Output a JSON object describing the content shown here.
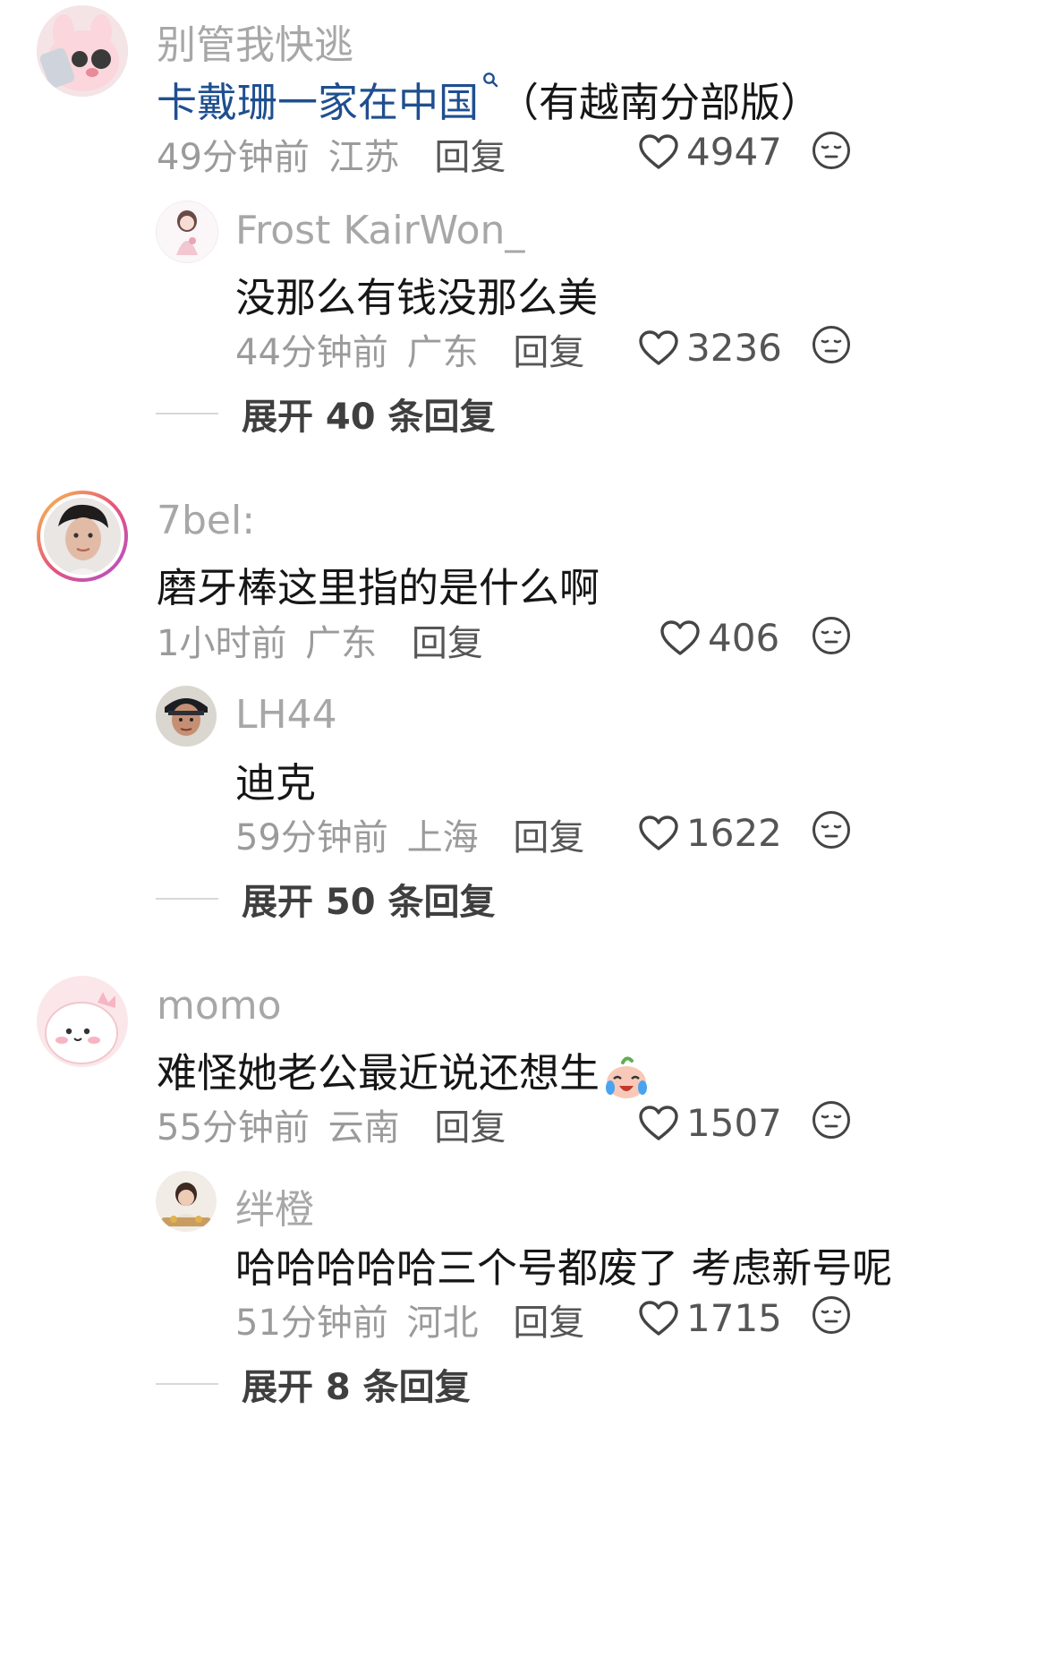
{
  "comments": [
    {
      "user": "别管我快逃",
      "text_link": "卡戴珊一家在中国",
      "text_after": "（有越南分部版）",
      "time": "49分钟前",
      "region": "江苏",
      "reply_label": "回复",
      "likes": "4947",
      "reply": {
        "user": "Frost KairWon_",
        "text": "没那么有钱没那么美",
        "time": "44分钟前",
        "region": "广东",
        "reply_label": "回复",
        "likes": "3236"
      },
      "expand_label": "展开 40 条回复"
    },
    {
      "user": "7bel:",
      "text": "磨牙棒这里指的是什么啊",
      "time": "1小时前",
      "region": "广东",
      "reply_label": "回复",
      "likes": "406",
      "reply": {
        "user": "LH44",
        "text": "迪克",
        "time": "59分钟前",
        "region": "上海",
        "reply_label": "回复",
        "likes": "1622"
      },
      "expand_label": "展开 50 条回复"
    },
    {
      "user": "momo",
      "text": "难怪她老公最近说还想生",
      "time": "55分钟前",
      "region": "云南",
      "reply_label": "回复",
      "likes": "1507",
      "reply": {
        "user": "绊橙",
        "text": "哈哈哈哈哈三个号都废了 考虑新号呢",
        "time": "51分钟前",
        "region": "河北",
        "reply_label": "回复",
        "likes": "1715"
      },
      "expand_label": "展开 8 条回复"
    }
  ],
  "icons": {
    "like": "heart-outline-icon",
    "react": "neutral-face-icon",
    "search": "search-icon"
  },
  "colors": {
    "link": "#1f4f8f",
    "text": "#161616",
    "meta": "#9b9b9b"
  }
}
